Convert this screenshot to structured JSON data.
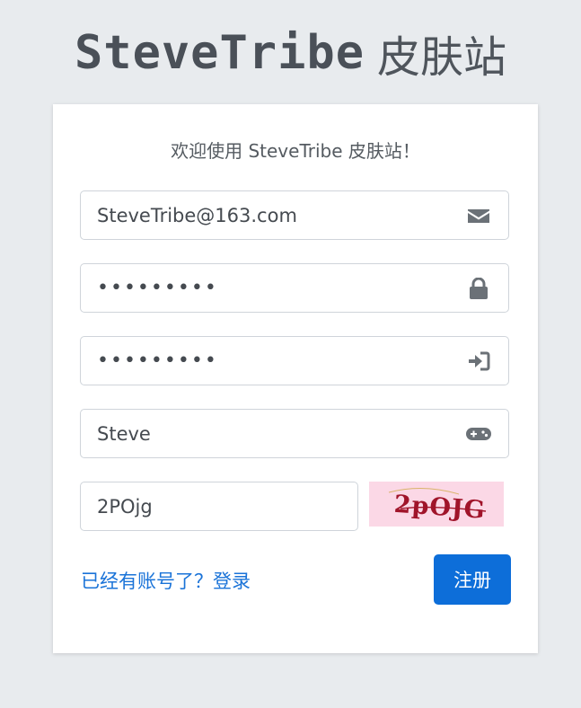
{
  "header": {
    "brand": "SteveTribe",
    "suffix": "皮肤站"
  },
  "form": {
    "welcome": "欢迎使用 SteveTribe 皮肤站！",
    "email": {
      "value": "SteveTribe@163.com",
      "icon": "envelope-icon"
    },
    "password": {
      "value": "•••••••••",
      "icon": "lock-icon"
    },
    "confirm_password": {
      "value": "•••••••••",
      "icon": "sign-in-icon"
    },
    "nickname": {
      "value": "Steve",
      "icon": "gamepad-icon"
    },
    "captcha": {
      "value": "2POjg",
      "image_text": "2pOJG"
    },
    "login_link": "已经有账号了？登录",
    "register_button": "注册"
  },
  "colors": {
    "background": "#e8ebee",
    "primary": "#0d6ed9",
    "link": "#1a73d8",
    "icon": "#555b61",
    "captcha_bg": "#fbd8e6",
    "captcha_text": "#a0142a"
  }
}
